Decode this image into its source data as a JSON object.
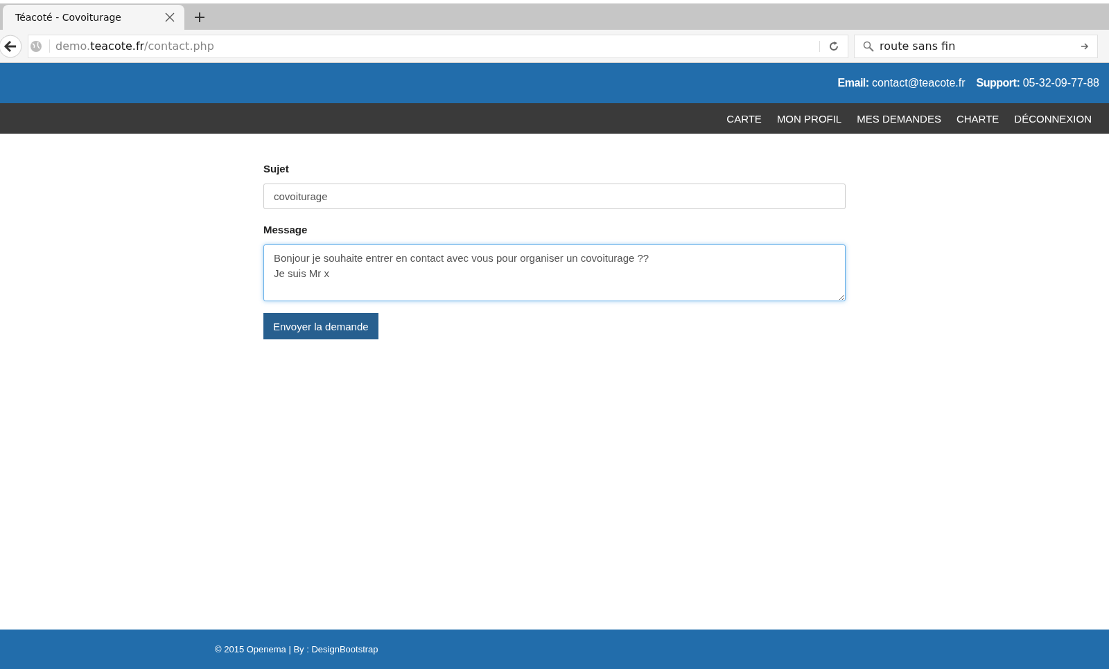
{
  "browser": {
    "tab_title": "Téacoté - Covoiturage",
    "url": {
      "prefix": "demo.",
      "host": "teacote.fr",
      "path": "/contact.php"
    },
    "search": {
      "value": "route sans fin"
    }
  },
  "header": {
    "contacts": [
      "**Email:** contact@teacote.fr",
      "**Support:** 05-32-09-77-88"
    ]
  },
  "nav": {
    "items": [
      {
        "label": "CARTE"
      },
      {
        "label": "MON PROFIL"
      },
      {
        "label": "MES DEMANDES"
      },
      {
        "label": "CHARTE"
      },
      {
        "label": "DÉCONNEXION"
      }
    ]
  },
  "form": {
    "fields": [
      {
        "kind": "input",
        "label": "Sujet",
        "value": "covoiturage",
        "focused": false
      },
      {
        "kind": "textarea",
        "label": "Message",
        "value": "Bonjour je souhaite entrer en contact avec vous pour organiser un covoiturage ??\nJe suis Mr x ",
        "focused": true
      }
    ],
    "submit": "Envoyer la demande"
  },
  "footer": {
    "text": "© 2015 Openema | By : DesignBootstrap"
  }
}
